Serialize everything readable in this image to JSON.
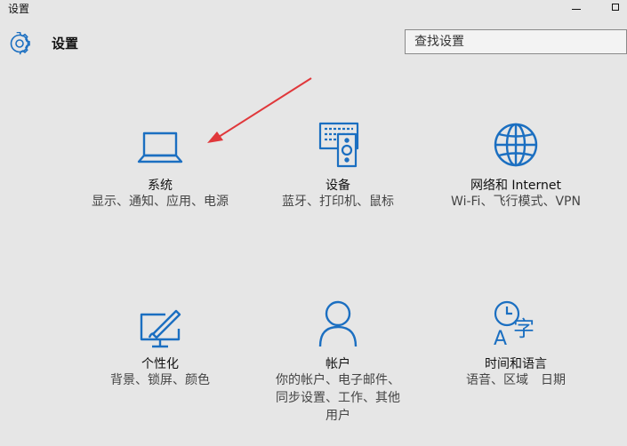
{
  "window": {
    "title": "设置"
  },
  "header": {
    "title": "设置",
    "icon": "gear-icon"
  },
  "search": {
    "placeholder": "查找设置",
    "value": ""
  },
  "accent_color": "#1b6fc1",
  "annotation_arrow_color": "#e0383b",
  "tiles": [
    {
      "id": "system",
      "icon": "laptop-icon",
      "title": "系统",
      "description": "显示、通知、应用、电源"
    },
    {
      "id": "devices",
      "icon": "devices-icon",
      "title": "设备",
      "description": "蓝牙、打印机、鼠标"
    },
    {
      "id": "network",
      "icon": "globe-icon",
      "title": "网络和 Internet",
      "description": "Wi-Fi、飞行模式、VPN"
    },
    {
      "id": "personalization",
      "icon": "personalization-icon",
      "title": "个性化",
      "description": "背景、锁屏、颜色"
    },
    {
      "id": "accounts",
      "icon": "person-icon",
      "title": "帐户",
      "description": "你的帐户、电子邮件、同步设置、工作、其他用户"
    },
    {
      "id": "time-language",
      "icon": "time-language-icon",
      "title": "时间和语言",
      "description": "语音、区域　日期"
    }
  ]
}
